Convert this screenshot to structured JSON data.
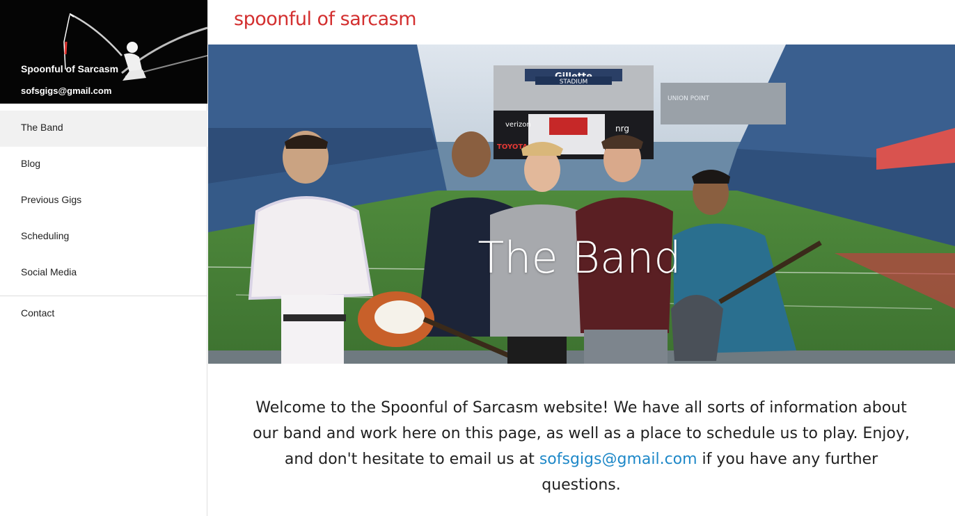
{
  "sidebar": {
    "site_name": "Spoonful of Sarcasm",
    "email": "sofsgigs@gmail.com",
    "nav_items": [
      {
        "label": "The Band",
        "active": true
      },
      {
        "label": "Blog",
        "active": false
      },
      {
        "label": "Previous Gigs",
        "active": false
      },
      {
        "label": "Scheduling",
        "active": false
      },
      {
        "label": "Social Media",
        "active": false
      }
    ],
    "contact_label": "Contact"
  },
  "header": {
    "title": "spoonful of sarcasm",
    "title_color": "#d32f2f"
  },
  "hero": {
    "title": "The Band",
    "stadium_sign": "Gillette",
    "stadium_sub": "STADIUM",
    "side_sign": "UNION  POINT",
    "screen_top": "verizon",
    "screen_right": "nrg",
    "sponsor": "TOYOTA"
  },
  "welcome": {
    "text_before": "Welcome to the Spoonful of Sarcasm website! We have all sorts of information about our band and work here on this page, as well as a place to schedule us to play. Enjoy, and don't hesitate to email us at ",
    "email_link": "sofsgigs@gmail.com",
    "text_after": " if you have any further questions.",
    "link_color": "#1e88c8"
  }
}
